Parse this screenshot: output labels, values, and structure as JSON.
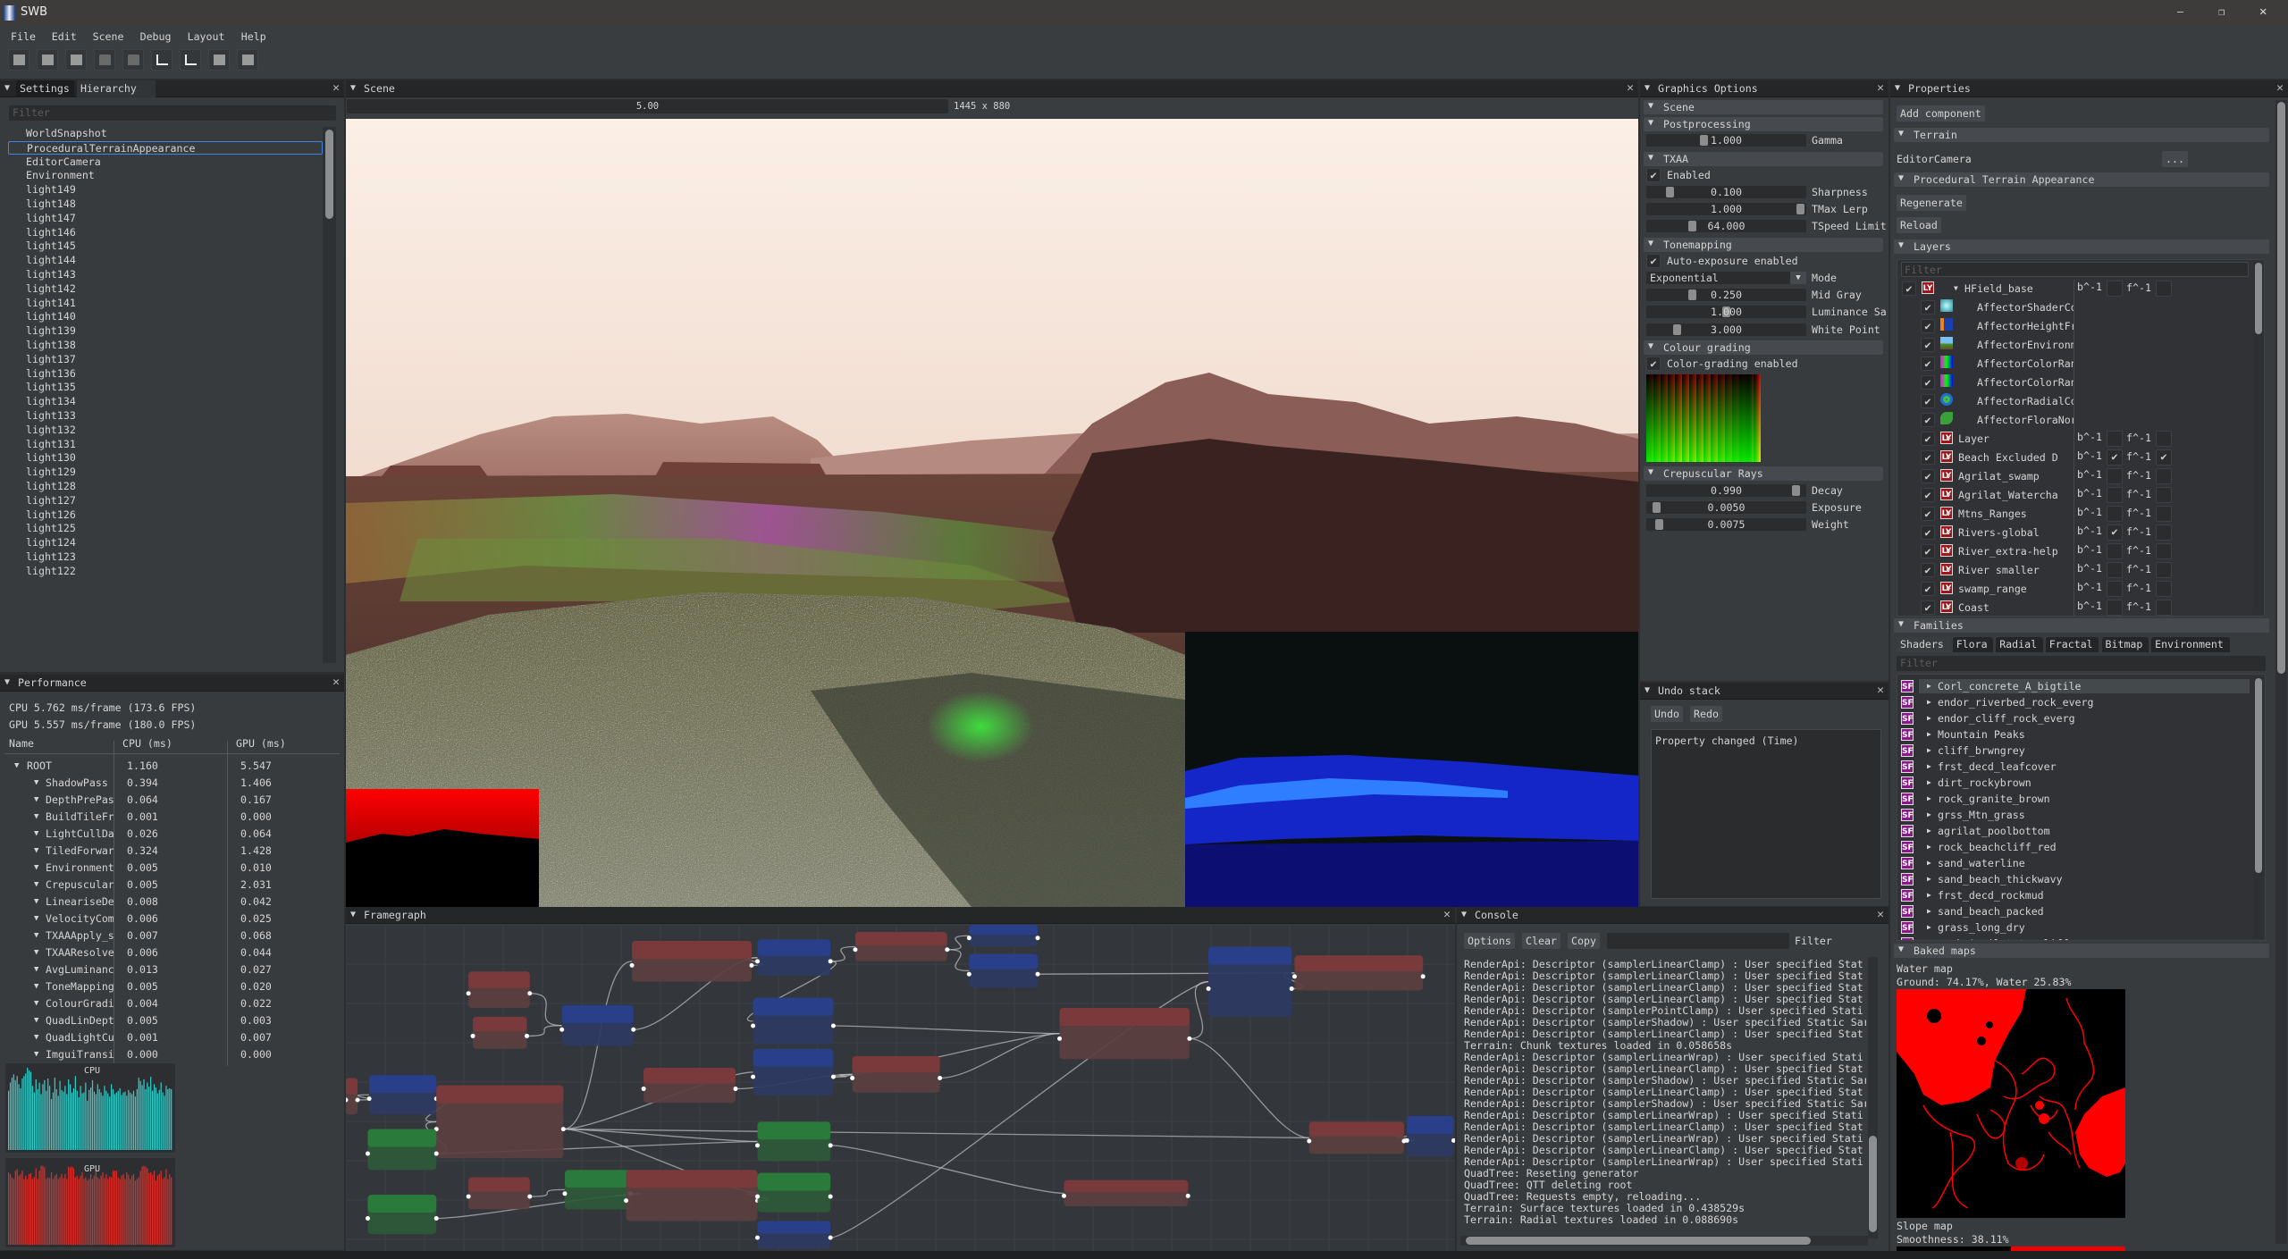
{
  "window": {
    "title": "SWB"
  },
  "menu": [
    "File",
    "Edit",
    "Scene",
    "Debug",
    "Layout",
    "Help"
  ],
  "toolbar": [
    "new-entity-icon",
    "undo-entity-icon",
    "clone-entity-icon",
    "open-folder-icon",
    "open-folder-more-icon",
    "local-axis-icon",
    "world-axis-icon",
    "group-icon",
    "link-icon"
  ],
  "hierarchy": {
    "tabs": [
      "Settings",
      "Hierarchy"
    ],
    "filter_placeholder": "Filter",
    "selected_index": 1,
    "items": [
      "WorldSnapshot",
      "ProceduralTerrainAppearance",
      "EditorCamera",
      "Environment",
      "light149",
      "light148",
      "light147",
      "light146",
      "light145",
      "light144",
      "light143",
      "light142",
      "light141",
      "light140",
      "light139",
      "light138",
      "light137",
      "light136",
      "light135",
      "light134",
      "light133",
      "light132",
      "light131",
      "light130",
      "light129",
      "light128",
      "light127",
      "light126",
      "light125",
      "light124",
      "light123",
      "light122"
    ]
  },
  "performance": {
    "title": "Performance",
    "cpu_summary": "CPU 5.762 ms/frame (173.6 FPS)",
    "gpu_summary": "GPU 5.557 ms/frame (180.0 FPS)",
    "columns": [
      "Name",
      "CPU (ms)",
      "GPU (ms)"
    ],
    "root": {
      "name": "ROOT",
      "cpu": "1.160",
      "gpu": "5.547"
    },
    "rows": [
      {
        "name": "ShadowPass",
        "cpu": "0.394",
        "gpu": "1.406"
      },
      {
        "name": "DepthPrePas",
        "cpu": "0.064",
        "gpu": "0.167"
      },
      {
        "name": "BuildTileFr",
        "cpu": "0.001",
        "gpu": "0.000"
      },
      {
        "name": "LightCullDa",
        "cpu": "0.026",
        "gpu": "0.064"
      },
      {
        "name": "TiledForwar",
        "cpu": "0.324",
        "gpu": "1.428"
      },
      {
        "name": "Environment",
        "cpu": "0.005",
        "gpu": "0.010"
      },
      {
        "name": "Crepuscular",
        "cpu": "0.005",
        "gpu": "2.031"
      },
      {
        "name": "LineariseDe",
        "cpu": "0.008",
        "gpu": "0.042"
      },
      {
        "name": "VelocityCom",
        "cpu": "0.006",
        "gpu": "0.025"
      },
      {
        "name": "TXAAApply_s",
        "cpu": "0.007",
        "gpu": "0.068"
      },
      {
        "name": "TXAAResolve",
        "cpu": "0.006",
        "gpu": "0.044"
      },
      {
        "name": "AvgLuminanc",
        "cpu": "0.013",
        "gpu": "0.027"
      },
      {
        "name": "ToneMapping",
        "cpu": "0.005",
        "gpu": "0.020"
      },
      {
        "name": "ColourGradi",
        "cpu": "0.004",
        "gpu": "0.022"
      },
      {
        "name": "QuadLinDept",
        "cpu": "0.005",
        "gpu": "0.003"
      },
      {
        "name": "QuadLightCu",
        "cpu": "0.001",
        "gpu": "0.007"
      },
      {
        "name": "ImguiTransi",
        "cpu": "0.000",
        "gpu": "0.000"
      }
    ],
    "cpu_graph": {
      "label": "CPU",
      "color": "#2fd0cc",
      "values": [
        0.72,
        0.82,
        0.88,
        0.92,
        0.85,
        0.9,
        0.8,
        0.75,
        0.87,
        0.9,
        0.93,
        1.0,
        0.97,
        0.95,
        0.78,
        0.7,
        0.86,
        0.74,
        0.82,
        0.68,
        0.8,
        0.85,
        0.72,
        0.87,
        0.78,
        0.62,
        0.7,
        0.88,
        0.74,
        0.66,
        0.84,
        0.73,
        0.71,
        0.78,
        0.68,
        0.86,
        0.8,
        0.7,
        0.75,
        0.9,
        0.72,
        0.64,
        0.78,
        0.69,
        0.7,
        0.82,
        0.6,
        0.73,
        0.76,
        0.85,
        0.71,
        0.68,
        0.8,
        0.74,
        0.7,
        0.66,
        0.78,
        0.72,
        0.69,
        0.65,
        0.8,
        0.74,
        0.68,
        0.7,
        0.72,
        0.75,
        0.67,
        0.7,
        0.71,
        0.66,
        0.73,
        0.7,
        0.68,
        0.72,
        0.65,
        0.74,
        0.88,
        0.84,
        0.79,
        0.86,
        0.74,
        0.82,
        0.77,
        0.89,
        0.72,
        0.8,
        0.76,
        0.69,
        0.73,
        0.82,
        0.7,
        0.66,
        0.78,
        0.74,
        0.75,
        0.74
      ]
    },
    "gpu_graph": {
      "label": "GPU",
      "color": "#d8302c",
      "values": [
        0.88,
        0.86,
        0.82,
        0.8,
        0.9,
        0.92,
        0.84,
        0.86,
        0.9,
        0.8,
        0.84,
        0.8,
        0.86,
        0.87,
        0.8,
        0.82,
        0.93,
        0.8,
        0.9,
        0.96,
        0.96,
        0.94,
        0.8,
        0.82,
        0.81,
        0.88,
        0.8,
        0.84,
        0.86,
        0.8,
        0.82,
        0.86,
        0.81,
        0.86,
        0.8,
        0.95,
        0.94,
        0.95,
        0.93,
        0.82,
        0.84,
        0.8,
        0.84,
        0.88,
        0.8,
        0.82,
        0.78,
        0.8,
        0.86,
        0.8,
        0.84,
        0.92,
        0.82,
        0.8,
        0.84,
        0.88,
        0.81,
        0.86,
        0.8,
        0.83,
        0.82,
        0.9,
        0.9,
        0.9,
        0.82,
        0.8,
        0.84,
        0.86,
        0.8,
        0.88,
        0.85,
        0.8,
        0.84,
        0.86,
        0.78,
        0.8,
        0.82,
        0.9,
        0.95,
        0.96,
        0.95,
        0.93,
        0.87,
        0.88,
        0.85,
        0.9,
        0.78,
        0.84,
        0.86,
        0.9,
        0.8,
        0.82,
        0.92,
        0.8,
        0.86,
        0.82
      ]
    }
  },
  "scene": {
    "title": "Scene",
    "speed": "5.00",
    "resolution": "1445 x 880"
  },
  "graphics": {
    "title": "Graphics Options",
    "sections": {
      "scene": "Scene",
      "post": "Postprocessing",
      "txaa": "TXAA",
      "tone": "Tonemapping",
      "grading": "Colour grading",
      "crep": "Crepuscular Rays"
    },
    "gamma": {
      "label": "Gamma",
      "value": "1.000",
      "fraction": 0.35
    },
    "txaa_enabled": {
      "label": "Enabled",
      "checked": true
    },
    "sharpness": {
      "label": "Sharpness",
      "value": "0.100",
      "fraction": 0.12
    },
    "tmax": {
      "label": "TMax Lerp",
      "value": "1.000",
      "fraction": 1.0
    },
    "tspeed": {
      "label": "TSpeed Limit",
      "value": "64.000",
      "fraction": 0.27
    },
    "auto_exposure": {
      "label": "Auto-exposure enabled",
      "checked": true
    },
    "mode": {
      "label": "Mode",
      "value": "Exponential"
    },
    "midgray": {
      "label": "Mid Gray",
      "value": "0.250",
      "fraction": 0.27
    },
    "luminance": {
      "label": "Luminance Sa",
      "value": "1.000",
      "fraction": 0.5
    },
    "whitepoint": {
      "label": "White Point",
      "value": "3.000",
      "fraction": 0.17
    },
    "grading_enabled": {
      "label": "Color-grading enabled",
      "checked": true
    },
    "decay": {
      "label": "Decay",
      "value": "0.990",
      "fraction": 0.97
    },
    "exposure": {
      "label": "Exposure",
      "value": "0.0050",
      "fraction": 0.03
    },
    "weight": {
      "label": "Weight",
      "value": "0.0075",
      "fraction": 0.05
    }
  },
  "undo": {
    "title": "Undo stack",
    "undo": "Undo",
    "redo": "Redo",
    "entries": [
      "Property changed (Time)"
    ]
  },
  "properties": {
    "title": "Properties",
    "add_component": "Add component",
    "terrain_header": "Terrain",
    "camera_label": "EditorCamera",
    "camera_button": "...",
    "pta_header": "Procedural Terrain Appearance",
    "regenerate": "Regenerate",
    "reload": "Reload",
    "layers_header": "Layers",
    "filter_placeholder": "Filter",
    "b_label": "b^-1",
    "f_label": "f^-1",
    "layers": [
      {
        "kind": "layer",
        "name": "HField_base",
        "enabled": true,
        "expanded": true,
        "b": false,
        "f": false
      },
      {
        "kind": "affector",
        "icon": "shader",
        "name": "AffectorShaderCo",
        "enabled": true
      },
      {
        "kind": "affector",
        "icon": "height",
        "name": "AffectorHeightFr",
        "enabled": true
      },
      {
        "kind": "affector",
        "icon": "environment",
        "name": "AffectorEnvironm",
        "enabled": true
      },
      {
        "kind": "affector",
        "icon": "colorramp",
        "name": "AffectorColorRan",
        "enabled": true
      },
      {
        "kind": "affector",
        "icon": "colorramp",
        "name": "AffectorColorRan",
        "enabled": true
      },
      {
        "kind": "affector",
        "icon": "radial",
        "name": "AffectorRadialCo",
        "enabled": true
      },
      {
        "kind": "affector",
        "icon": "flora",
        "name": "AffectorFloraNor",
        "enabled": true
      },
      {
        "kind": "layer",
        "name": "Layer",
        "enabled": true,
        "b": false,
        "f": false
      },
      {
        "kind": "layer",
        "name": "Beach Excluded D",
        "enabled": true,
        "b": true,
        "f": true
      },
      {
        "kind": "layer",
        "name": "Agrilat_swamp",
        "enabled": true,
        "b": false,
        "f": false
      },
      {
        "kind": "layer",
        "name": "Agrilat_Watercha",
        "enabled": true,
        "b": false,
        "f": false
      },
      {
        "kind": "layer",
        "name": "Mtns_Ranges",
        "enabled": true,
        "b": false,
        "f": false
      },
      {
        "kind": "layer",
        "name": "Rivers-global",
        "enabled": true,
        "b": true,
        "f": false
      },
      {
        "kind": "layer",
        "name": "River_extra-help",
        "enabled": true,
        "b": false,
        "f": false
      },
      {
        "kind": "layer",
        "name": "River smaller",
        "enabled": true,
        "b": false,
        "f": false
      },
      {
        "kind": "layer",
        "name": "swamp_range",
        "enabled": true,
        "b": false,
        "f": false
      },
      {
        "kind": "layer",
        "name": "Coast",
        "enabled": true,
        "b": false,
        "f": false
      }
    ],
    "layer_badge": "LY",
    "families_header": "Families",
    "family_tabs": [
      "Shaders",
      "Flora",
      "Radial",
      "Fractal",
      "Bitmap",
      "Environment"
    ],
    "family_badge": "SF",
    "families": [
      "Corl_concrete_A_bigtile",
      "endor_riverbed_rock_everg",
      "endor_cliff_rock_everg",
      "Mountain Peaks",
      "cliff_brwngrey",
      "frst_decd_leafcover",
      "dirt_rockybrown",
      "rock_granite_brown",
      "grss_Mtn_grass",
      "agrilat_poolbottom",
      "rock_beachcliff_red",
      "sand_waterline",
      "sand_beach_thickwavy",
      "frst_decd_rockmud",
      "sand_beach_packed",
      "grass_long_dry",
      "rock_Agrilat_topcliff"
    ],
    "baked_header": "Baked maps",
    "water_label": "Water map",
    "water_stats": "Ground: 74.17%, Water 25.83%",
    "slope_label": "Slope map",
    "slope_stats": "Smoothness: 38.11%"
  },
  "framegraph": {
    "title": "Framegraph"
  },
  "console": {
    "title": "Console",
    "options": "Options",
    "clear": "Clear",
    "copy": "Copy",
    "filter_label": "Filter",
    "filter_value": "",
    "lines": [
      "RenderApi: Descriptor (samplerLinearClamp) : User specified Stat",
      "RenderApi: Descriptor (samplerLinearClamp) : User specified Stat",
      "RenderApi: Descriptor (samplerLinearClamp) : User specified Stat",
      "RenderApi: Descriptor (samplerLinearClamp) : User specified Stat",
      "RenderApi: Descriptor (samplerPointClamp) : User specified Stati",
      "RenderApi: Descriptor (samplerShadow) : User specified Static Sar",
      "RenderApi: Descriptor (samplerLinearClamp) : User specified Stat",
      "Terrain: Chunk textures loaded in 0.058658s",
      "RenderApi: Descriptor (samplerLinearWrap) : User specified Stati",
      "RenderApi: Descriptor (samplerLinearClamp) : User specified Stat",
      "RenderApi: Descriptor (samplerShadow) : User specified Static Sar",
      "RenderApi: Descriptor (samplerLinearClamp) : User specified Stat",
      "RenderApi: Descriptor (samplerShadow) : User specified Static Sar",
      "RenderApi: Descriptor (samplerLinearWrap) : User specified Stati",
      "RenderApi: Descriptor (samplerLinearClamp) : User specified Stat",
      "RenderApi: Descriptor (samplerLinearWrap) : User specified Stati",
      "RenderApi: Descriptor (samplerLinearClamp) : User specified Stat",
      "RenderApi: Descriptor (samplerLinearWrap) : User specified Stati",
      "QuadTree: Reseting generator",
      "QuadTree: QTT deleting root",
      "QuadTree: Requests empty, reloading...",
      "Terrain: Surface textures loaded in 0.438529s",
      "Terrain: Radial textures loaded in 0.088690s"
    ]
  }
}
